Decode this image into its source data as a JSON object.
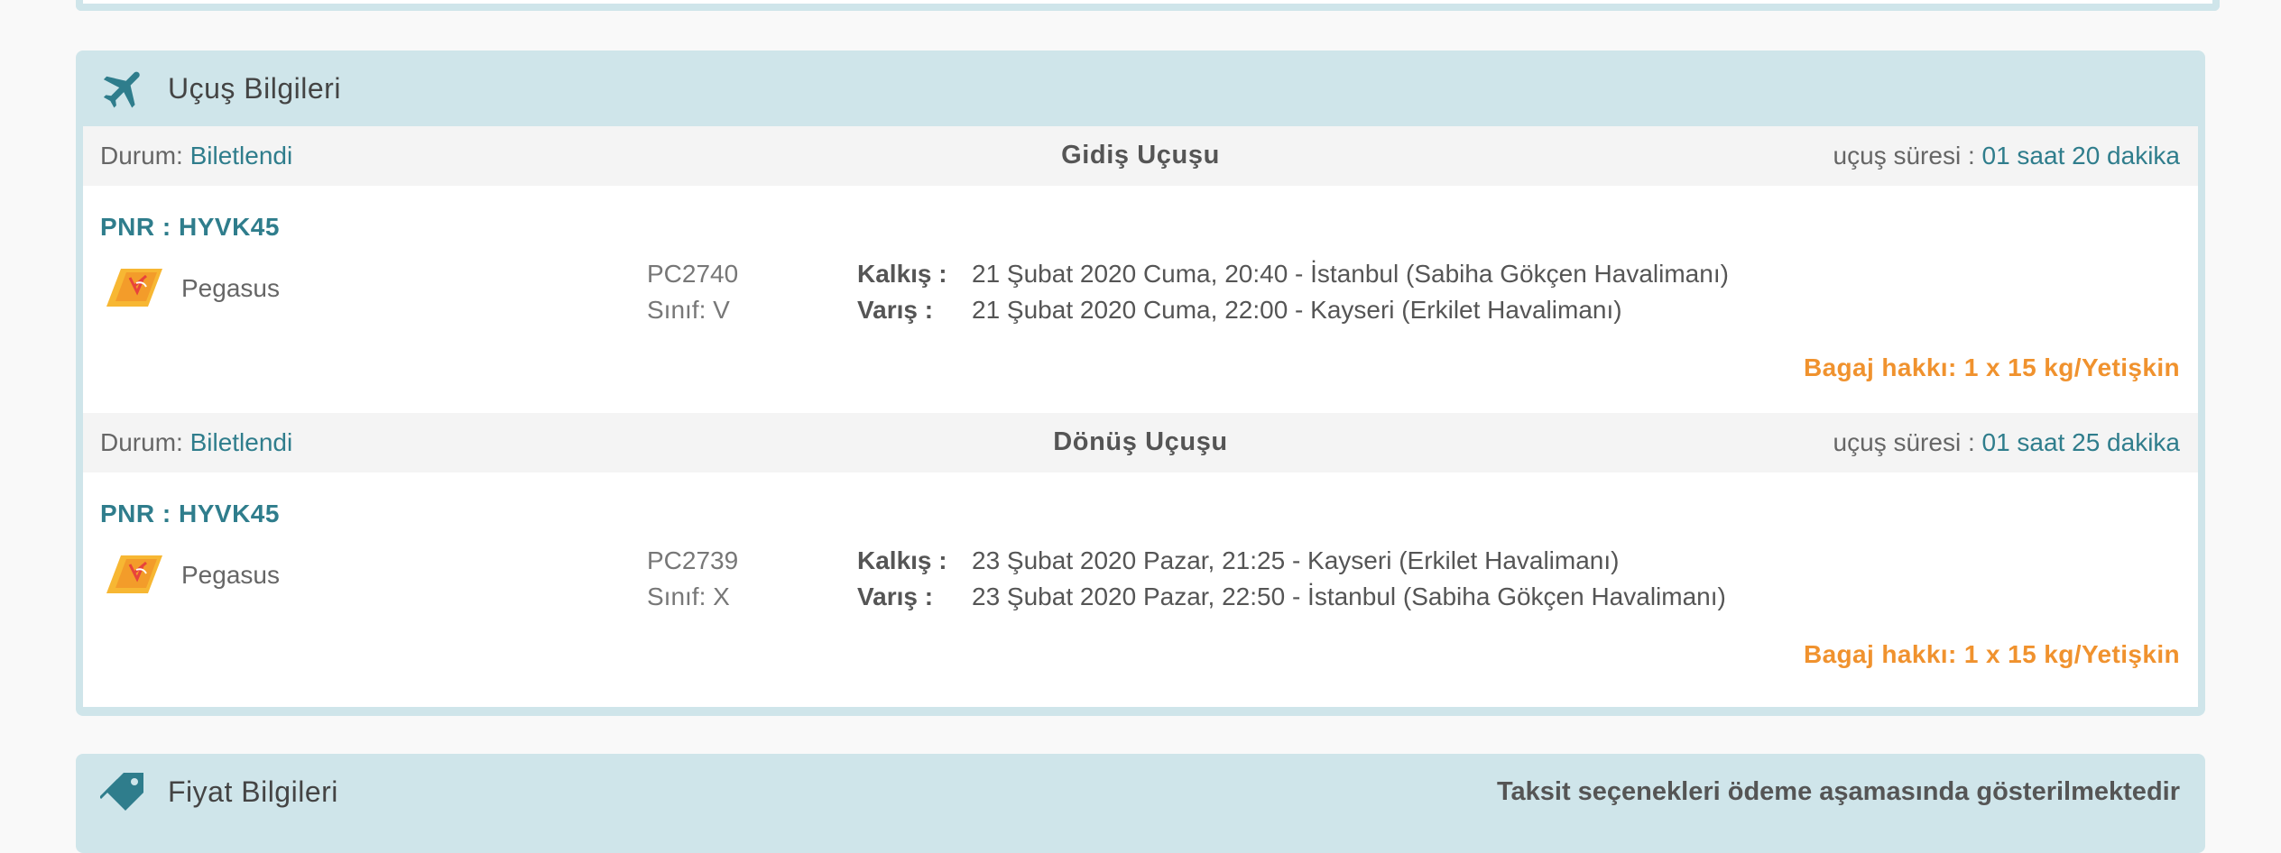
{
  "flight_panel": {
    "title": "Uçuş Bilgileri",
    "icon": "airplane-icon",
    "legs": [
      {
        "status_label": "Durum:",
        "status_value": "Biletlendi",
        "title": "Gidiş Uçuşu",
        "duration_label": "uçuş süresi :",
        "duration_value": "01 saat 20 dakika",
        "pnr": "PNR : HYVK45",
        "airline": "Pegasus",
        "flight_no": "PC2740",
        "flight_class": "Sınıf: V",
        "departure_label": "Kalkış :",
        "departure_value": "21 Şubat 2020 Cuma, 20:40 - İstanbul (Sabiha Gökçen Havalimanı)",
        "arrival_label": "Varış :",
        "arrival_value": "21 Şubat 2020 Cuma, 22:00 - Kayseri (Erkilet Havalimanı)",
        "baggage": "Bagaj hakkı: 1 x 15 kg/Yetişkin"
      },
      {
        "status_label": "Durum:",
        "status_value": "Biletlendi",
        "title": "Dönüş Uçuşu",
        "duration_label": "uçuş süresi :",
        "duration_value": "01 saat 25 dakika",
        "pnr": "PNR : HYVK45",
        "airline": "Pegasus",
        "flight_no": "PC2739",
        "flight_class": "Sınıf: X",
        "departure_label": "Kalkış :",
        "departure_value": "23 Şubat 2020 Pazar, 21:25 - Kayseri (Erkilet Havalimanı)",
        "arrival_label": "Varış :",
        "arrival_value": "23 Şubat 2020 Pazar, 22:50 - İstanbul (Sabiha Gökçen Havalimanı)",
        "baggage": "Bagaj hakkı: 1 x 15 kg/Yetişkin"
      }
    ]
  },
  "price_panel": {
    "title": "Fiyat Bilgileri",
    "icon": "price-tag-icon",
    "note": "Taksit seçenekleri ödeme aşamasında gösterilmektedir"
  },
  "colors": {
    "panel_bg": "#cfe5ea",
    "accent_teal": "#2f7d8c",
    "baggage_orange": "#f0922e",
    "bar_bg": "#f4f4f4"
  }
}
